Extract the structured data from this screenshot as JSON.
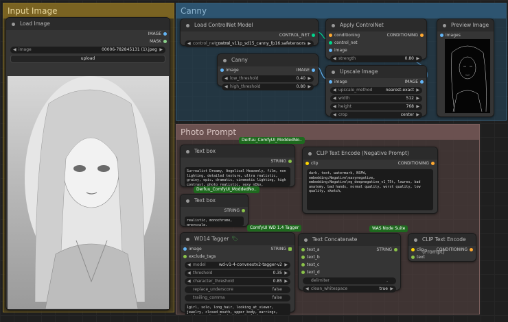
{
  "groups": {
    "input_image": "Input Image",
    "canny": "Canny",
    "photo_prompt": "Photo Prompt"
  },
  "load_image": {
    "title": "Load Image",
    "out_image": "IMAGE",
    "out_mask": "MASK",
    "widget_label": "image",
    "widget_value": "00006-782845131 (1).jpeg",
    "upload": "upload"
  },
  "load_controlnet": {
    "title": "Load ControlNet Model",
    "out": "CONTROL_NET",
    "widget_label": "control_net_name",
    "widget_value": "control_v11p_sd15_canny_fp16.safetensors"
  },
  "apply_controlnet": {
    "title": "Apply ControlNet",
    "in_conditioning": "conditioning",
    "in_control_net": "control_net",
    "in_image": "image",
    "out": "CONDITIONING",
    "strength_label": "strength",
    "strength_value": "0.80"
  },
  "preview_image": {
    "title": "Preview Image",
    "in_images": "images"
  },
  "canny_node": {
    "title": "Canny",
    "in_image": "image",
    "out": "IMAGE",
    "low_label": "low_threshold",
    "low_value": "0.40",
    "high_label": "high_threshold",
    "high_value": "0.80"
  },
  "upscale": {
    "title": "Upscale Image",
    "in_image": "image",
    "out": "IMAGE",
    "method_label": "upscale_method",
    "method_value": "nearest-exact",
    "width_label": "width",
    "width_value": "512",
    "height_label": "height",
    "height_value": "768",
    "crop_label": "crop",
    "crop_value": "center"
  },
  "textbox1": {
    "badge": "Derfuu_ComfyUI_ModdedNo..",
    "title": "Text box",
    "out": "STRING",
    "text": "Surrealist Dreamy, Angelical Heavenly, film, non lighting, detailed texture, ultra realistic, grainy, epic, dramatic, cinematic lighting, high contrast, photo realistic, sexy nIkv,"
  },
  "textbox2": {
    "badge": "Derfuu_ComfyUI_ModdedNo..",
    "title": "Text box",
    "out": "STRING",
    "text": "realistic, monochrome, greyscale,"
  },
  "clip_neg": {
    "title": "CLIP Text Encode (Negative Prompt)",
    "in_clip": "clip",
    "out": "CONDITIONING",
    "text": "dark, text, watermark, NSFW, embedding:Negative\\easynegative, embedding:Negative\\ng_deepnegative_v1_75t, lowres, bad anatomy, bad hands, normal quality, worst quality, low quality, sketch,"
  },
  "wd14": {
    "badge": "ComfyUI WD 1.4 Tagger",
    "title": "WD14 Tagger",
    "in_image": "image",
    "in_exclude": "exclude_tags",
    "out": "STRING",
    "model_label": "model",
    "model_value": "wd-v1-4-convnextv2-tagger-v2",
    "threshold_label": "threshold",
    "threshold_value": "0.35",
    "char_label": "character_threshold",
    "char_value": "0.85",
    "replace_label": "replace_underscore",
    "replace_value": "false",
    "trailing_label": "trailing_comma",
    "trailing_value": "false",
    "output_text": "1girl, solo, long_hair, looking_at_viewer, jewelry, closed_mouth, upper_body, earrings, outdoors, sky, cloud, lips, eyelashes, floating_hair,"
  },
  "concat": {
    "badge": "WAS Node Suite",
    "title": "Text Concatenate",
    "in_a": "text_a",
    "in_b": "text_b",
    "in_c": "text_c",
    "in_d": "text_d",
    "out": "STRING",
    "delim_label": "delimiter",
    "delim_value": ",",
    "clean_label": "clean_whitespace",
    "clean_value": "true"
  },
  "clip_pos": {
    "title": "CLIP Text Encode (Prompt)",
    "in_clip": "clip",
    "in_text": "text",
    "out": "CONDITIONING"
  },
  "colors": {
    "input_group": "#6e5a1e",
    "canny_group": "#27485e",
    "photo_group": "#5a4543",
    "link_image": "#64b5f6",
    "link_string": "#8bc34a",
    "link_conditioning": "#ffa931",
    "link_controlnet": "#00d78d",
    "badge": "#1f6a1f"
  }
}
